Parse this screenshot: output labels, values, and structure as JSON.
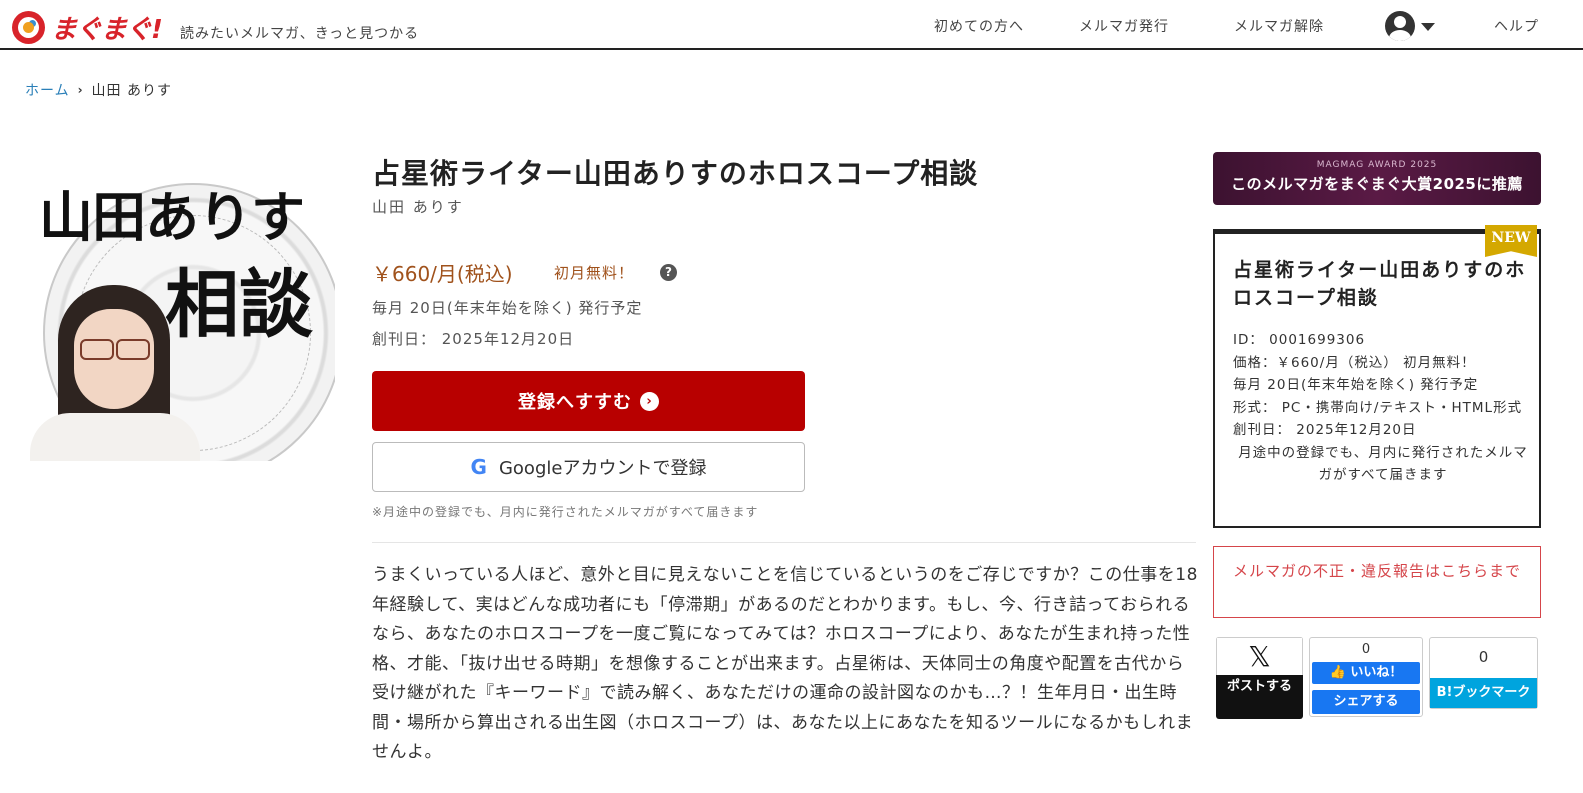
{
  "header": {
    "logo_text": "まぐまぐ!",
    "tagline": "読みたいメルマガ、きっと見つかる",
    "nav": [
      "初めての方へ",
      "メルマガ発行",
      "メルマガ解除",
      "ヘルプ"
    ]
  },
  "breadcrumb": {
    "home": "ホーム",
    "current": "山田 ありす"
  },
  "cover": {
    "name_text": "山田ありす",
    "sodan_text": "相談"
  },
  "magazine": {
    "title": "占星術ライター山田ありすのホロスコープ相談",
    "author": "山田 ありす",
    "price": "￥660/月(税込)",
    "price_note": "初月無料！",
    "help": "?",
    "schedule": "毎月 20日(年末年始を除く) 発行予定",
    "founded": "創刊日： 2025年12月20日",
    "subscribe_label": "登録へすすむ",
    "subscribe_arrow": "›",
    "google_g": "G",
    "google_label": "Googleアカウントで登録",
    "notice": "※月途中の登録でも、月内に発行されたメルマガがすべて届きます",
    "description": "うまくいっている人ほど、意外と目に見えないことを信じているというのをご存じですか？この仕事を18年経験して、実はどんな成功者にも「停滞期」があるのだとわかります。もし、今、行き詰っておられるなら、あなたのホロスコープを一度ご覧になってみては？ホロスコープにより、あなたが生まれ持った性格、才能、「抜け出せる時期」を想像することが出来ます。占星術は、天体同士の角度や配置を古代から受け継がれた『キーワード』で読み解く、あなただけの運命の設計図なのかも…？！生年月日・出生時間・場所から算出される出生図（ホロスコープ）は、あなた以上にあなたを知るツールになるかもしれませんよ。"
  },
  "sidebar": {
    "award_small": "MAGMAG AWARD 2025",
    "award_main": "このメルマガをまぐまぐ大賞2025に推薦",
    "new_badge": "NEW",
    "info_title": "占星術ライター山田ありすのホロスコープ相談",
    "info_id": "ID： 0001699306",
    "info_price": "価格：￥660/月（税込） 初月無料！",
    "info_schedule": "毎月 20日(年末年始を除く) 発行予定",
    "info_format": "形式： PC・携帯向け/テキスト・HTML形式",
    "info_founded": "創刊日： 2025年12月20日",
    "info_note": "月途中の登録でも、月内に発行されたメルマガがすべて届きます",
    "report": "メルマガの不正・違反報告はこちらまで"
  },
  "share": {
    "x_glyph": "𝕏",
    "x_label": "ポストする",
    "fb_count": "0",
    "fb_like": "👍 いいね！",
    "fb_share": "シェアする",
    "hb_count": "0",
    "hb_label": "B!ブックマーク"
  },
  "colors": {
    "brand_red": "#d8232a",
    "subscribe_button": "#b80000",
    "price": "#a0521c",
    "link": "#2a7fb8",
    "award_bg": "#3c1230",
    "new_badge": "#d4a800",
    "facebook": "#1877f2",
    "hatena": "#00a4de"
  }
}
